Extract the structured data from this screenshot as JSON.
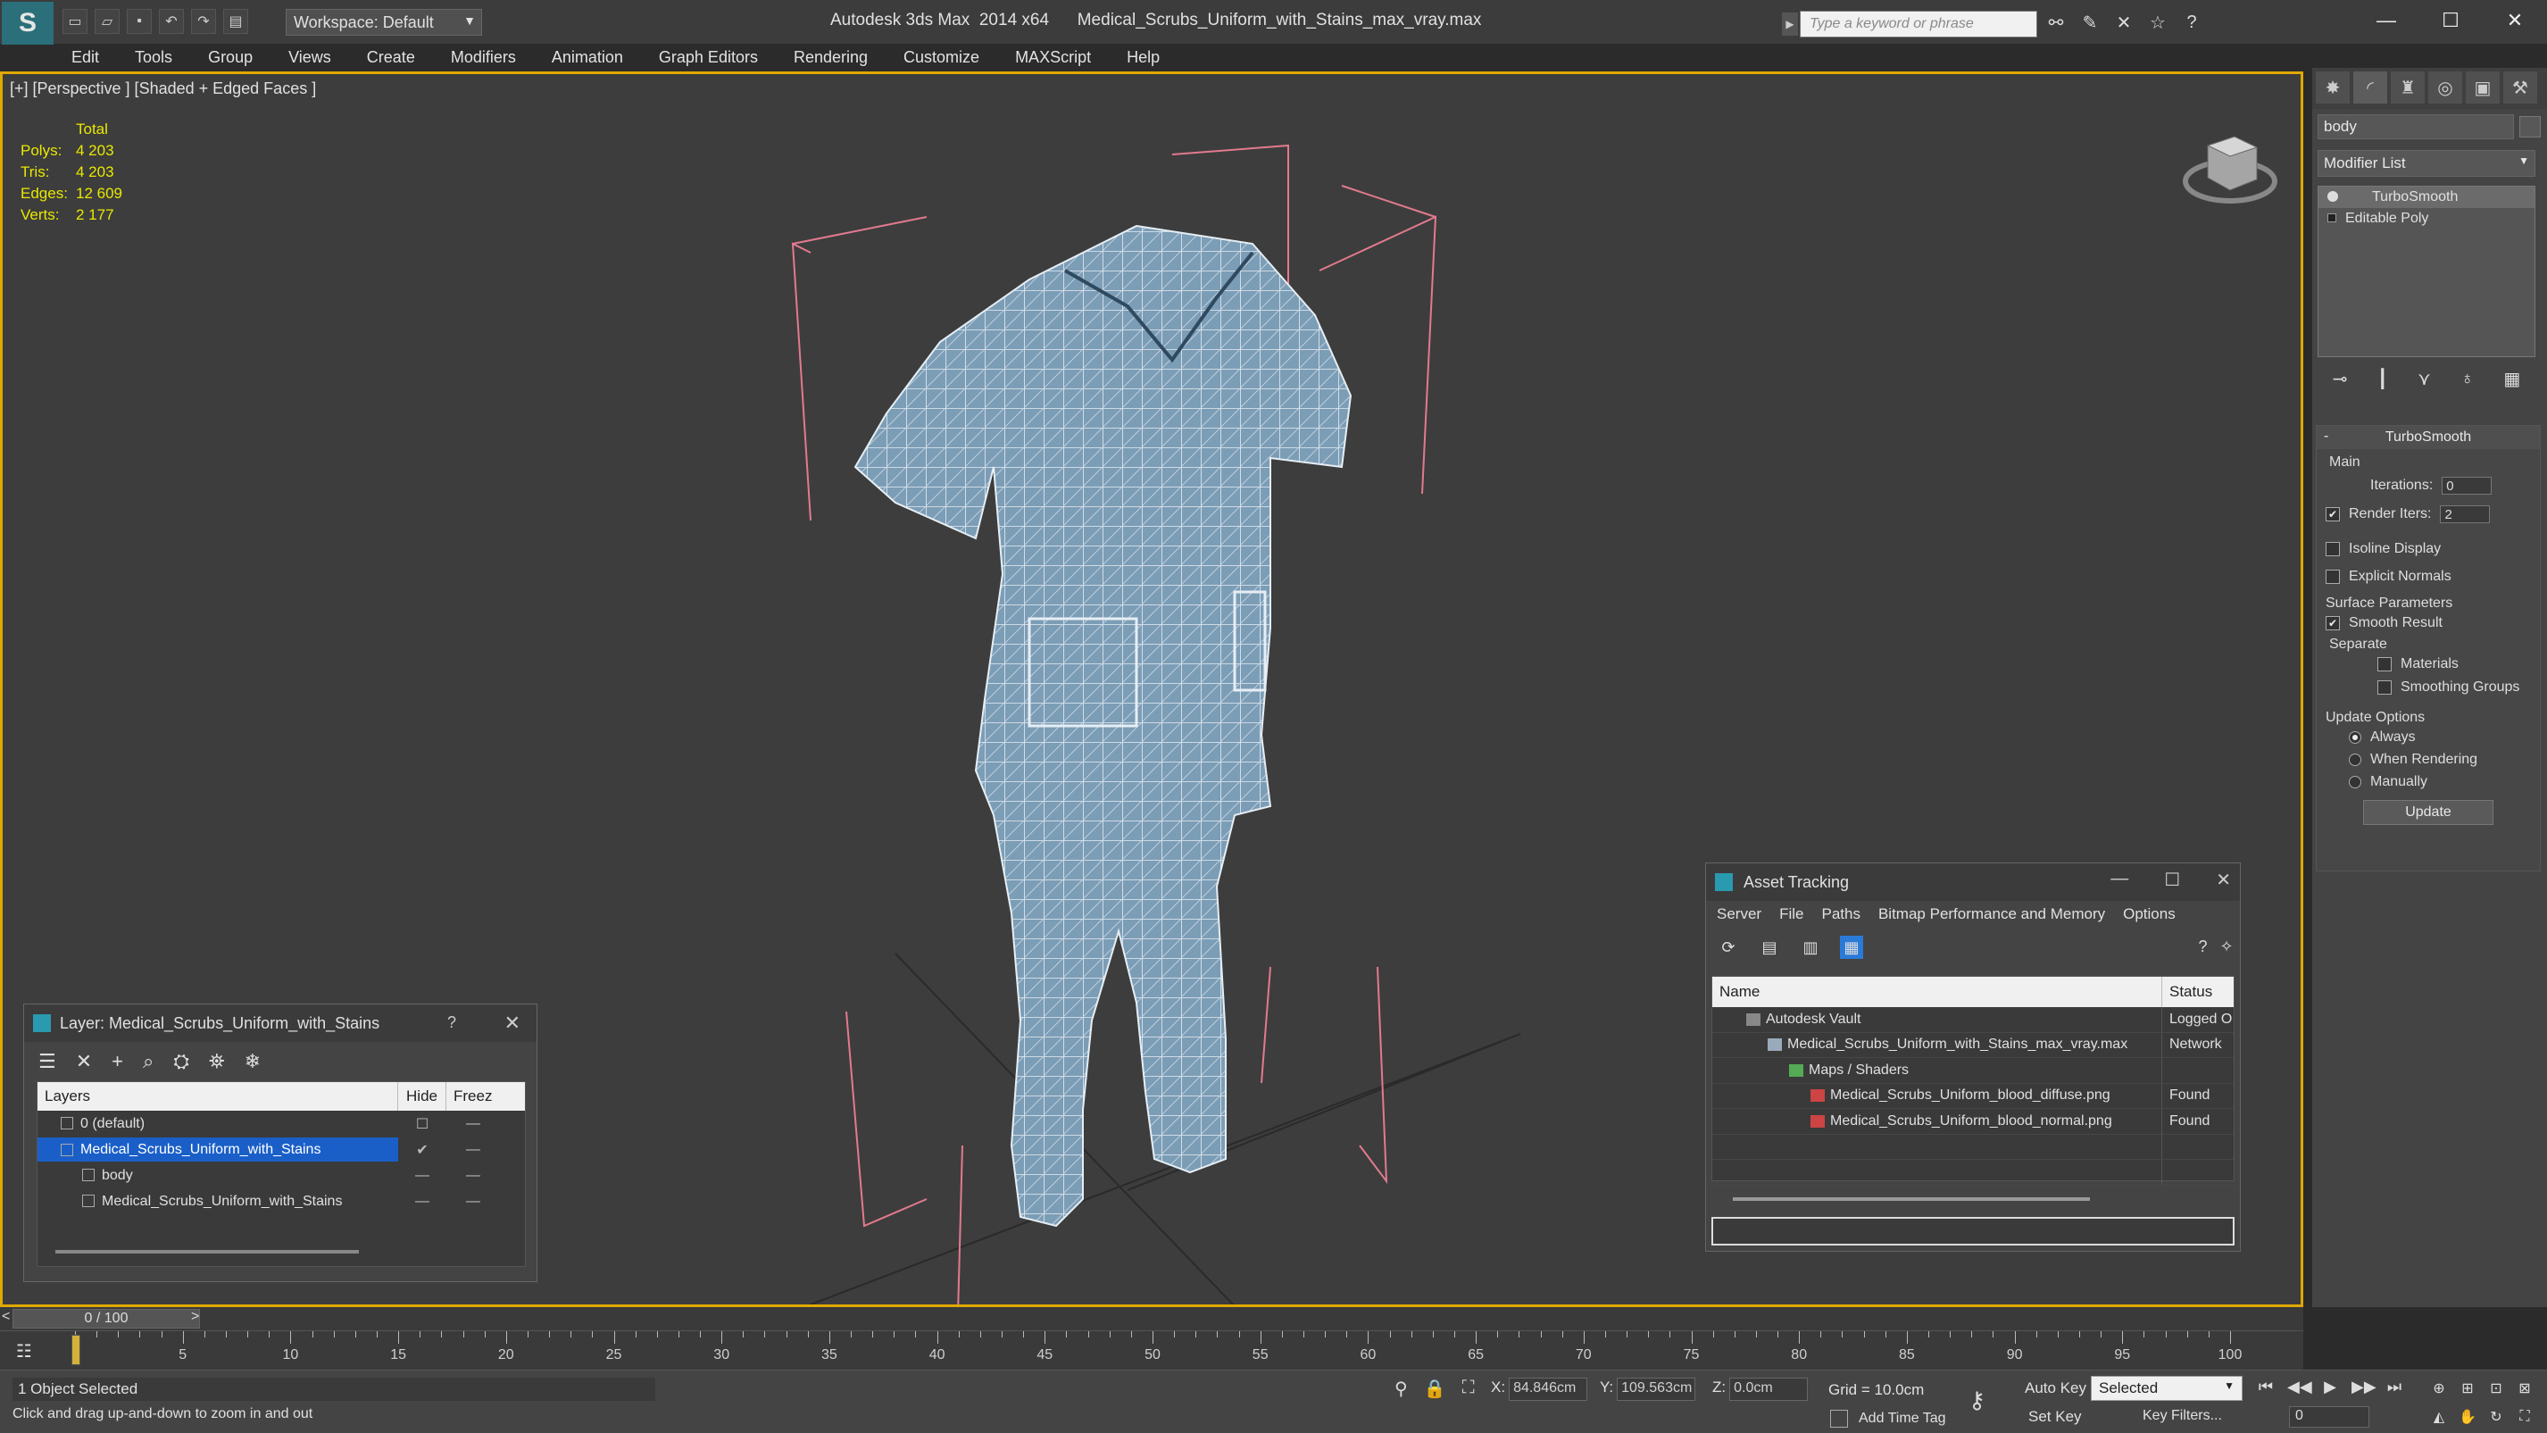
{
  "app": {
    "title": "Autodesk 3ds Max  2014 x64",
    "file": "Medical_Scrubs_Uniform_with_Stains_max_vray.max",
    "workspace": "Workspace: Default",
    "search_placeholder": "Type a keyword or phrase",
    "accent": "#e0a800"
  },
  "menu": [
    "Edit",
    "Tools",
    "Group",
    "Views",
    "Create",
    "Modifiers",
    "Animation",
    "Graph Editors",
    "Rendering",
    "Customize",
    "MAXScript",
    "Help"
  ],
  "viewport": {
    "label": "[+] [Perspective ] [Shaded + Edged Faces ]",
    "stats": {
      "header": "Total",
      "rows": [
        {
          "k": "Polys:",
          "v": "4 203"
        },
        {
          "k": "Tris:",
          "v": "4 203"
        },
        {
          "k": "Edges:",
          "v": "12 609"
        },
        {
          "k": "Verts:",
          "v": "2 177"
        }
      ]
    }
  },
  "command_panel": {
    "object_name": "body",
    "modifier_list": "Modifier List",
    "stack": [
      "TurboSmooth",
      "Editable Poly"
    ],
    "rollout": {
      "title": "TurboSmooth",
      "main": "Main",
      "iterations_label": "Iterations:",
      "iterations": "0",
      "render_iters_label": "Render Iters:",
      "render_iters": "2",
      "isoline": "Isoline Display",
      "explicit": "Explicit Normals",
      "surface_params": "Surface Parameters",
      "smooth_result": "Smooth Result",
      "separate": "Separate",
      "materials": "Materials",
      "smoothing_groups": "Smoothing Groups",
      "update_options": "Update Options",
      "always": "Always",
      "when_rendering": "When Rendering",
      "manually": "Manually",
      "update": "Update"
    }
  },
  "layer_window": {
    "title": "Layer: Medical_Scrubs_Uniform_with_Stains",
    "help": "?",
    "col_layers": "Layers",
    "col_hide": "Hide",
    "col_freeze": "Freez",
    "rows": [
      {
        "name": "0 (default)",
        "indent": 1
      },
      {
        "name": "Medical_Scrubs_Uniform_with_Stains",
        "indent": 1
      },
      {
        "name": "body",
        "indent": 2
      },
      {
        "name": "Medical_Scrubs_Uniform_with_Stains",
        "indent": 2
      }
    ]
  },
  "asset_window": {
    "title": "Asset Tracking",
    "menu": [
      "Server",
      "File",
      "Paths",
      "Bitmap Performance and Memory",
      "Options"
    ],
    "col_name": "Name",
    "col_status": "Status",
    "rows": [
      {
        "name": "Autodesk Vault",
        "status": "Logged O"
      },
      {
        "name": "Medical_Scrubs_Uniform_with_Stains_max_vray.max",
        "status": "Network"
      },
      {
        "name": "Maps / Shaders",
        "status": ""
      },
      {
        "name": "Medical_Scrubs_Uniform_blood_diffuse.png",
        "status": "Found"
      },
      {
        "name": "Medical_Scrubs_Uniform_blood_normal.png",
        "status": "Found"
      }
    ]
  },
  "timeline": {
    "slider": "0 / 100",
    "ticks": [
      "5",
      "10",
      "15",
      "20",
      "25",
      "30",
      "35",
      "40",
      "45",
      "50",
      "55",
      "60",
      "65",
      "70",
      "75",
      "80",
      "85",
      "90",
      "95",
      "100"
    ]
  },
  "status": {
    "selected": "1 Object Selected",
    "prompt": "Click and drag up-and-down to zoom in and out",
    "x_label": "X:",
    "x": "84.846cm",
    "y_label": "Y:",
    "y": "109.563cm",
    "z_label": "Z:",
    "z": "0.0cm",
    "grid": "Grid = 10.0cm",
    "add_time_tag": "Add Time Tag",
    "auto_key": "Auto Key",
    "set_key": "Set Key",
    "selected_dd": "Selected",
    "key_filters": "Key Filters...",
    "frame": "0"
  }
}
